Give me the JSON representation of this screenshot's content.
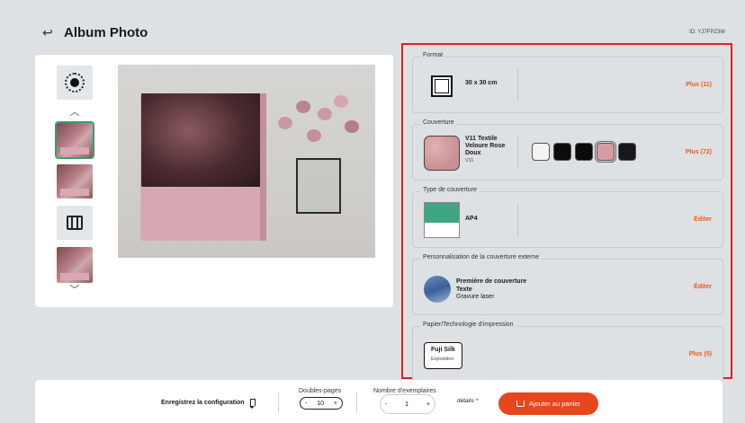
{
  "header": {
    "back_icon": "arrow-left-icon",
    "title": "Album Photo",
    "product_id": "ID: YJ7FPZ3W"
  },
  "gallery": {
    "thumbs": [
      {
        "kind": "icon",
        "icon": "lux-badge-icon"
      },
      {
        "kind": "image",
        "active": true
      },
      {
        "kind": "image",
        "active": false
      },
      {
        "kind": "icon",
        "icon": "film-icon"
      },
      {
        "kind": "image",
        "active": false
      }
    ]
  },
  "options": {
    "format": {
      "title": "Format",
      "value": "30 x 30 cm",
      "action": "Plus (11)"
    },
    "cover": {
      "title": "Couverture",
      "name": "V11 Textile Veloure Rose Doux",
      "code": "V11",
      "action": "Plus (72)",
      "colors": [
        "#f4f4f4",
        "#0c0c0c",
        "#0a0a0a",
        "#d99ba1",
        "#15181d"
      ],
      "selected_color_index": 3
    },
    "cover_type": {
      "title": "Type de couverture",
      "value": "AP4",
      "action": "Éditer"
    },
    "personalisation": {
      "title": "Personnalisation de la couverture externe",
      "line1": "Première de couverture",
      "line2": "Texte",
      "line3": "Gravure laser",
      "action": "Éditer"
    },
    "paper": {
      "title": "Papier/Technologie d'impression",
      "name": "Fuji Silk",
      "sub": "Exposition",
      "action": "Plus (5)"
    }
  },
  "bottom": {
    "save_label": "Enregistrez la configuration",
    "spreads_label": "Doubles-pages",
    "spreads_value": "10",
    "copies_label": "Nombre d'exemplaires",
    "copies_value": "1",
    "details_label": "détails ^",
    "cart_label": "Ajouter au panier",
    "minus": "-",
    "plus": "+"
  }
}
